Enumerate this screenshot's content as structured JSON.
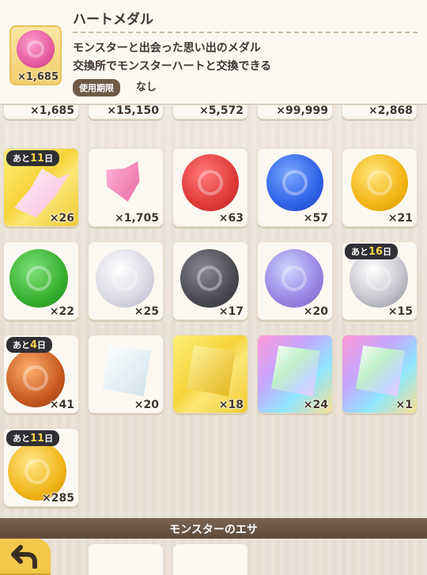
{
  "info": {
    "title": "ハートメダル",
    "line1": "モンスターと出会った思い出のメダル",
    "line2": "交換所でモンスターハートと交換できる",
    "badge": "使用期限",
    "badge_value": "なし",
    "thumb_count": "×1,685",
    "thumb_icon": "pink-heart-medal-icon"
  },
  "partial_row": [
    "×1,685",
    "×15,150",
    "×5,572",
    "×99,999",
    "×2,868"
  ],
  "rows": [
    [
      {
        "icon": "pink-tail-icon",
        "count": "×26",
        "timer_prefix": "あと",
        "timer_num": "11",
        "timer_suffix": "日",
        "bg": "gold"
      },
      {
        "icon": "heart-piece-icon",
        "count": "×1,705"
      },
      {
        "icon": "red-medal-icon",
        "count": "×63"
      },
      {
        "icon": "blue-medal-icon",
        "count": "×57"
      },
      {
        "icon": "yellow-medal-icon",
        "count": "×21"
      }
    ],
    [
      {
        "icon": "green-medal-icon",
        "count": "×22"
      },
      {
        "icon": "silver-medal-icon",
        "count": "×25"
      },
      {
        "icon": "black-medal-icon",
        "count": "×17"
      },
      {
        "icon": "purple-swirl-medal-icon",
        "count": "×20"
      },
      {
        "icon": "silver-eye-medal-icon",
        "count": "×15",
        "timer_prefix": "あと",
        "timer_num": "16",
        "timer_suffix": "日"
      }
    ],
    [
      {
        "icon": "bronze-medal-icon",
        "count": "×41",
        "timer_prefix": "あと",
        "timer_num": "4",
        "timer_suffix": "日"
      },
      {
        "icon": "white-scroll-icon",
        "count": "×20"
      },
      {
        "icon": "gold-scroll-icon",
        "count": "×18",
        "bg": "gold"
      },
      {
        "icon": "rainbow-scroll-icon",
        "count": "×24",
        "bg": "rainbow"
      },
      {
        "icon": "rainbow-scroll-icon",
        "count": "×1",
        "bg": "rainbow"
      }
    ],
    [
      {
        "icon": "gold-medal-icon",
        "count": "×285",
        "timer_prefix": "あと",
        "timer_num": "11",
        "timer_suffix": "日"
      }
    ]
  ],
  "section": {
    "title": "モンスターのエサ"
  },
  "back_button": {
    "icon": "back-arrow-icon"
  }
}
